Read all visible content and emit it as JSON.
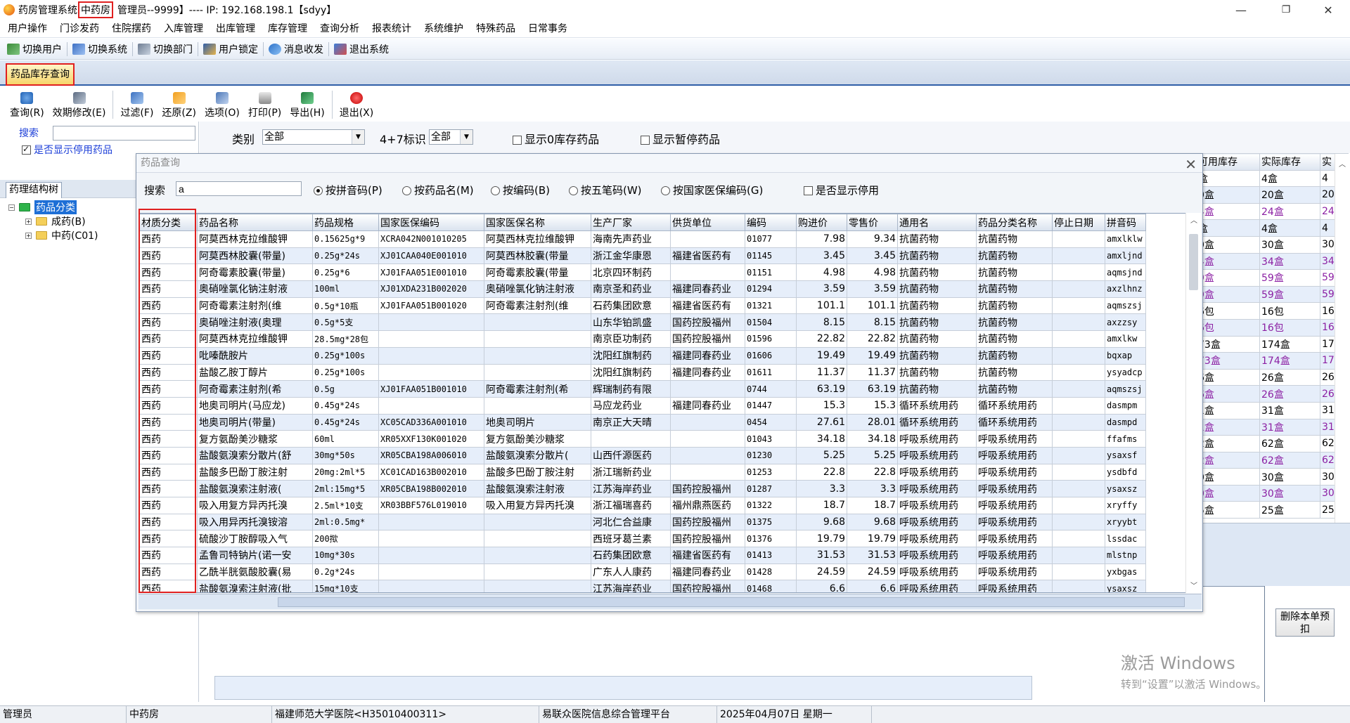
{
  "window": {
    "app_name": "药房管理系统",
    "dept": "中药房",
    "title_rest": "管理员--9999】---- IP: 192.168.198.1【sdyy】",
    "min": "—",
    "restore": "❐",
    "close": "✕"
  },
  "menu": [
    "用户操作",
    "门诊发药",
    "住院摆药",
    "入库管理",
    "出库管理",
    "库存管理",
    "查询分析",
    "报表统计",
    "系统维护",
    "特殊药品",
    "日常事务"
  ],
  "toolbar": [
    "切换用户",
    "切换系统",
    "切换部门",
    "用户锁定",
    "消息收发",
    "退出系统"
  ],
  "tab": "药品库存查询",
  "form_tools": [
    "查询(R)",
    "效期修改(E)",
    "过滤(F)",
    "还原(Z)",
    "选项(O)",
    "打印(P)",
    "导出(H)",
    "退出(X)"
  ],
  "left": {
    "search_label": "搜索",
    "search_value": "",
    "show_disabled": "是否显示停用药品"
  },
  "filter": {
    "category_label": "类别",
    "category_value": "全部",
    "flag47_label": "4+7标识",
    "flag47_value": "全部",
    "show_zero": "显示0库存药品",
    "show_paused": "显示暂停药品"
  },
  "tree": {
    "tab": "药理结构树",
    "root": "药品分类",
    "children": [
      "成药(B)",
      "中药(C01)"
    ]
  },
  "back_grid": {
    "headers": [
      "可用库存",
      "实际库存",
      "实"
    ],
    "rows": [
      [
        "盒",
        "4盒",
        "4"
      ],
      [
        "0盒",
        "20盒",
        "20"
      ],
      [
        "4盒",
        "24盒",
        "24"
      ],
      [
        "盒",
        "4盒",
        "4"
      ],
      [
        "0盒",
        "30盒",
        "30"
      ],
      [
        "4盒",
        "34盒",
        "34"
      ],
      [
        "9盒",
        "59盒",
        "59"
      ],
      [
        "9盒",
        "59盒",
        "59"
      ],
      [
        "6包",
        "16包",
        "16"
      ],
      [
        "6包",
        "16包",
        "16"
      ],
      [
        "73盒",
        "174盒",
        "17"
      ],
      [
        "73盒",
        "174盒",
        "17"
      ],
      [
        "6盒",
        "26盒",
        "26"
      ],
      [
        "6盒",
        "26盒",
        "26"
      ],
      [
        "1盒",
        "31盒",
        "31"
      ],
      [
        "1盒",
        "31盒",
        "31"
      ],
      [
        "2盒",
        "62盒",
        "62"
      ],
      [
        "2盒",
        "62盒",
        "62"
      ],
      [
        "0盒",
        "30盒",
        "30"
      ],
      [
        "0盒",
        "30盒",
        "30"
      ],
      [
        "5盒",
        "25盒",
        "25"
      ]
    ]
  },
  "delete_button": "删除本单预扣",
  "watermark": {
    "line1": "激活 Windows",
    "line2": "转到“设置”以激活 Windows。"
  },
  "status": [
    "管理员",
    "中药房",
    "福建师范大学医院<H35010400311>",
    "易联众医院信息综合管理平台",
    "2025年04月07日 星期一"
  ],
  "dialog": {
    "title": "药品查询",
    "search_label": "搜索",
    "search_value": "a",
    "radios": [
      "按拼音码(P)",
      "按药品名(M)",
      "按编码(B)",
      "按五笔码(W)",
      "按国家医保编码(G)"
    ],
    "show_disabled": "是否显示停用",
    "columns": [
      "材质分类",
      "药品名称",
      "药品规格",
      "国家医保编码",
      "国家医保名称",
      "生产厂家",
      "供货单位",
      "编码",
      "购进价",
      "零售价",
      "通用名",
      "药品分类名称",
      "停止日期",
      "拼音码"
    ],
    "rows": [
      [
        "西药",
        "阿莫西林克拉维酸钾",
        "0.15625g*9",
        "XCRA042N001010205",
        "阿莫西林克拉维酸钾",
        "海南先声药业",
        "",
        "01077",
        "7.98",
        "9.34",
        "抗菌药物",
        "抗菌药物",
        "",
        "amxlklw"
      ],
      [
        "西药",
        "阿莫西林胶囊(带量)",
        "0.25g*24s",
        "XJ01CAA040E001010",
        "阿莫西林胶囊(带量",
        "浙江金华康恩",
        "福建省医药有",
        "01145",
        "3.45",
        "3.45",
        "抗菌药物",
        "抗菌药物",
        "",
        "amxljnd"
      ],
      [
        "西药",
        "阿奇霉素胶囊(带量)",
        "0.25g*6",
        "XJ01FAA051E001010",
        "阿奇霉素胶囊(带量",
        "北京四环制药",
        "",
        "01151",
        "4.98",
        "4.98",
        "抗菌药物",
        "抗菌药物",
        "",
        "aqmsjnd"
      ],
      [
        "西药",
        "奥硝唑氯化钠注射液",
        "100ml",
        "XJ01XDA231B002020",
        "奥硝唑氯化钠注射液",
        "南京圣和药业",
        "福建同春药业",
        "01294",
        "3.59",
        "3.59",
        "抗菌药物",
        "抗菌药物",
        "",
        "axzlhnz"
      ],
      [
        "西药",
        "阿奇霉素注射剂(维",
        "0.5g*10瓶",
        "XJ01FAA051B001020",
        "阿奇霉素注射剂(维",
        "石药集团欧意",
        "福建省医药有",
        "01321",
        "101.1",
        "101.1",
        "抗菌药物",
        "抗菌药物",
        "",
        "aqmszsj"
      ],
      [
        "西药",
        "奥硝唑注射液(奥理",
        "0.5g*5支",
        "",
        "",
        "山东华铂凯盛",
        "国药控股福州",
        "01504",
        "8.15",
        "8.15",
        "抗菌药物",
        "抗菌药物",
        "",
        "axzzsy"
      ],
      [
        "西药",
        "阿莫西林克拉维酸钾",
        "28.5mg*28包",
        "",
        "",
        "南京臣功制药",
        "国药控股福州",
        "01596",
        "22.82",
        "22.82",
        "抗菌药物",
        "抗菌药物",
        "",
        "amxlkw"
      ],
      [
        "西药",
        "吡嗪酰胺片",
        "0.25g*100s",
        "",
        "",
        "沈阳红旗制药",
        "福建同春药业",
        "01606",
        "19.49",
        "19.49",
        "抗菌药物",
        "抗菌药物",
        "",
        "bqxap"
      ],
      [
        "西药",
        "盐酸乙胺丁醇片",
        "0.25g*100s",
        "",
        "",
        "沈阳红旗制药",
        "福建同春药业",
        "01611",
        "11.37",
        "11.37",
        "抗菌药物",
        "抗菌药物",
        "",
        "ysyadcp"
      ],
      [
        "西药",
        "阿奇霉素注射剂(希",
        "0.5g",
        "XJ01FAA051B001010",
        "阿奇霉素注射剂(希",
        "辉瑞制药有限",
        "",
        "0744",
        "63.19",
        "63.19",
        "抗菌药物",
        "抗菌药物",
        "",
        "aqmszsj"
      ],
      [
        "西药",
        "地奥司明片(马应龙)",
        "0.45g*24s",
        "",
        "",
        "马应龙药业",
        "福建同春药业",
        "01447",
        "15.3",
        "15.3",
        "循环系统用药",
        "循环系统用药",
        "",
        "dasmpm"
      ],
      [
        "西药",
        "地奥司明片(带量)",
        "0.45g*24s",
        "XC05CAD336A001010",
        "地奥司明片",
        "南京正大天晴",
        "",
        "0454",
        "27.61",
        "28.01",
        "循环系统用药",
        "循环系统用药",
        "",
        "dasmpd"
      ],
      [
        "西药",
        "复方氨酚美沙糖浆",
        "60ml",
        "XR05XXF130K001020",
        "复方氨酚美沙糖浆",
        "",
        "",
        "01043",
        "34.18",
        "34.18",
        "呼吸系统用药",
        "呼吸系统用药",
        "",
        "ffafms"
      ],
      [
        "西药",
        "盐酸氨溴索分散片(舒",
        "30mg*50s",
        "XR05CBA198A006010",
        "盐酸氨溴索分散片(",
        "山西仟源医药",
        "",
        "01230",
        "5.25",
        "5.25",
        "呼吸系统用药",
        "呼吸系统用药",
        "",
        "ysaxsf"
      ],
      [
        "西药",
        "盐酸多巴酚丁胺注射",
        "20mg:2ml*5",
        "XC01CAD163B002010",
        "盐酸多巴酚丁胺注射",
        "浙江瑞新药业",
        "",
        "01253",
        "22.8",
        "22.8",
        "呼吸系统用药",
        "呼吸系统用药",
        "",
        "ysdbfd"
      ],
      [
        "西药",
        "盐酸氨溴索注射液(",
        "2ml:15mg*5",
        "XR05CBA198B002010",
        "盐酸氨溴索注射液",
        "江苏海岸药业",
        "国药控股福州",
        "01287",
        "3.3",
        "3.3",
        "呼吸系统用药",
        "呼吸系统用药",
        "",
        "ysaxsz"
      ],
      [
        "西药",
        "吸入用复方异丙托溴",
        "2.5ml*10支",
        "XR03BBF576L019010",
        "吸入用复方异丙托溴",
        "浙江福瑞喜药",
        "福州鼎燕医药",
        "01322",
        "18.7",
        "18.7",
        "呼吸系统用药",
        "呼吸系统用药",
        "",
        "xryffy"
      ],
      [
        "西药",
        "吸入用异丙托溴铵溶",
        "2ml:0.5mg*",
        "",
        "",
        "河北仁合益康",
        "国药控股福州",
        "01375",
        "9.68",
        "9.68",
        "呼吸系统用药",
        "呼吸系统用药",
        "",
        "xryybt"
      ],
      [
        "西药",
        "硫酸沙丁胺醇吸入气",
        "200揿",
        "",
        "",
        "西班牙葛兰素",
        "国药控股福州",
        "01376",
        "19.79",
        "19.79",
        "呼吸系统用药",
        "呼吸系统用药",
        "",
        "lssdac"
      ],
      [
        "西药",
        "孟鲁司特钠片(诺一安",
        "10mg*30s",
        "",
        "",
        "石药集团欧意",
        "福建省医药有",
        "01413",
        "31.53",
        "31.53",
        "呼吸系统用药",
        "呼吸系统用药",
        "",
        "mlstnp"
      ],
      [
        "西药",
        "乙酰半胱氨酸胶囊(易",
        "0.2g*24s",
        "",
        "",
        "广东人人康药",
        "福建同春药业",
        "01428",
        "24.59",
        "24.59",
        "呼吸系统用药",
        "呼吸系统用药",
        "",
        "yxbgas"
      ],
      [
        "西药",
        "盐酸氨溴索注射液(批",
        "15mg*10支",
        "",
        "",
        "江苏海岸药业",
        "国药控股福州",
        "01468",
        "6.6",
        "6.6",
        "呼吸系统用药",
        "呼吸系统用药",
        "",
        "ysaxsz"
      ]
    ]
  }
}
